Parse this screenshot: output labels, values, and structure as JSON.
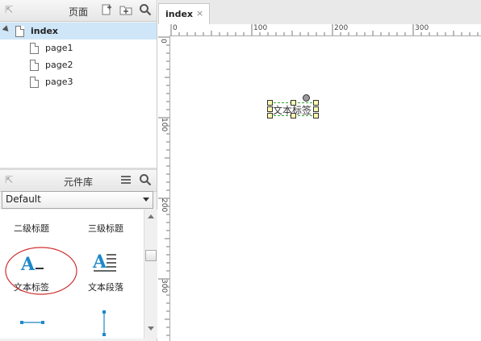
{
  "pages_panel": {
    "title": "页面",
    "pages": [
      {
        "label": "index",
        "selected": true
      },
      {
        "label": "page1",
        "selected": false
      },
      {
        "label": "page2",
        "selected": false
      },
      {
        "label": "page3",
        "selected": false
      }
    ]
  },
  "library_panel": {
    "title": "元件库",
    "selected_library": "Default",
    "widgets": [
      {
        "label": "二级标题"
      },
      {
        "label": "三级标题"
      },
      {
        "label": "文本标签"
      },
      {
        "label": "文本段落"
      }
    ]
  },
  "editor": {
    "tab_label": "index",
    "tab_close": "×",
    "ruler_h": [
      "0",
      "100",
      "200",
      "300"
    ],
    "ruler_v": [
      "0",
      "100",
      "200",
      "300"
    ],
    "canvas_widget_text": "文本标签"
  },
  "colors": {
    "selection": "#cfe6f8",
    "accent_blue": "#1e88c8",
    "annotation_red": "#d03030",
    "handle_yellow": "#fff7b0"
  }
}
